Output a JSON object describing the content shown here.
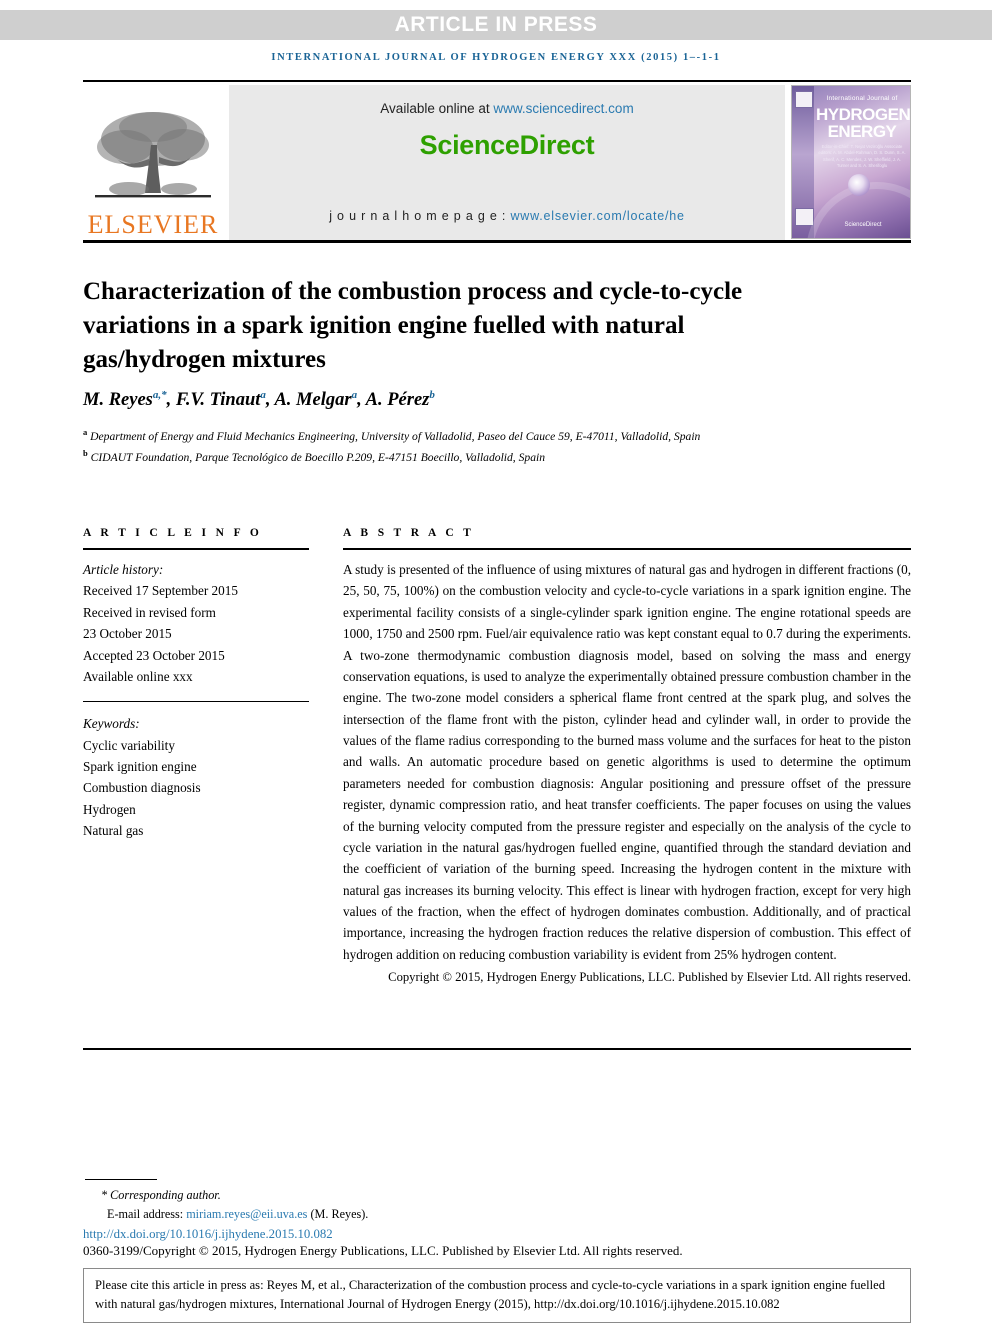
{
  "banner": {
    "text": "ARTICLE IN PRESS"
  },
  "running_head": {
    "text": "INTERNATIONAL JOURNAL OF HYDROGEN ENERGY XXX (2015) 1–‑1‑1"
  },
  "masthead": {
    "publisher_word": "ELSEVIER",
    "available_prefix": "Available online at ",
    "available_url": "www.sciencedirect.com",
    "sciencedirect_logo": "ScienceDirect",
    "homepage_prefix": "j o u r n a l   h o m e p a g e :  ",
    "homepage_url": "www.elsevier.com/locate/he",
    "cover": {
      "small_title": "International Journal of",
      "big_line1": "HYDROGEN",
      "big_line2": "ENERGY",
      "editors": "Editor-in-Chief: T. Nejat Veziroğlu   Associate editors: A. M. Abdel-Rahman, D. S. Dunn, S. A. Sherif, A. C. Mendes, J. W. Sheffield, J. A. Turner and S. A. Sherifoglu",
      "sciencedirect_mark": "ScienceDirect"
    }
  },
  "title": "Characterization of the combustion process and cycle-to-cycle variations in a spark ignition engine fuelled with natural gas/hydrogen mixtures",
  "authors": [
    {
      "name": "M. Reyes",
      "marks": "a,*"
    },
    {
      "name": "F.V. Tinaut",
      "marks": "a"
    },
    {
      "name": "A. Melgar",
      "marks": "a"
    },
    {
      "name": "A. Pérez",
      "marks": "b"
    }
  ],
  "affiliations": [
    {
      "mark": "a",
      "text": "Department of Energy and Fluid Mechanics Engineering, University of Valladolid, Paseo del Cauce 59, E-47011, Valladolid, Spain"
    },
    {
      "mark": "b",
      "text": "CIDAUT Foundation, Parque Tecnológico de Boecillo P.209, E-47151 Boecillo, Valladolid, Spain"
    }
  ],
  "article_info": {
    "heading": "A R T I C L E   I N F O",
    "history_label": "Article history:",
    "history": [
      "Received 17 September 2015",
      "Received in revised form",
      "23 October 2015",
      "Accepted 23 October 2015",
      "Available online xxx"
    ],
    "keywords_label": "Keywords:",
    "keywords": [
      "Cyclic variability",
      "Spark ignition engine",
      "Combustion diagnosis",
      "Hydrogen",
      "Natural gas"
    ]
  },
  "abstract": {
    "heading": "A B S T R A C T",
    "body": "A study is presented of the influence of using mixtures of natural gas and hydrogen in different fractions (0, 25, 50, 75, 100%) on the combustion velocity and cycle-to-cycle variations in a spark ignition engine. The experimental facility consists of a single-cylinder spark ignition engine. The engine rotational speeds are 1000, 1750 and 2500 rpm. Fuel/air equivalence ratio was kept constant equal to 0.7 during the experiments. A two-zone thermodynamic combustion diagnosis model, based on solving the mass and energy conservation equations, is used to analyze the experimentally obtained pressure combustion chamber in the engine. The two-zone model considers a spherical flame front centred at the spark plug, and solves the intersection of the flame front with the piston, cylinder head and cylinder wall, in order to provide the values of the flame radius corresponding to the burned mass volume and the surfaces for heat to the piston and walls. An automatic procedure based on genetic algorithms is used to determine the optimum parameters needed for combustion diagnosis: Angular positioning and pressure offset of the pressure register, dynamic compression ratio, and heat transfer coefficients. The paper focuses on using the values of the burning velocity computed from the pressure register and especially on the analysis of the cycle to cycle variation in the natural gas/hydrogen fuelled engine, quantified through the standard deviation and the coefficient of variation of the burning speed. Increasing the hydrogen content in the mixture with natural gas increases its burning velocity. This effect is linear with hydrogen fraction, except for very high values of the fraction, when the effect of hydrogen dominates combustion. Additionally, and of practical importance, increasing the hydrogen fraction reduces the relative dispersion of combustion. This effect of hydrogen addition on reducing combustion variability is evident from 25% hydrogen content.",
    "copyright": "Copyright © 2015, Hydrogen Energy Publications, LLC. Published by Elsevier Ltd. All rights reserved."
  },
  "footnotes": {
    "corresponding": "* Corresponding author.",
    "email_label": "E-mail address: ",
    "email": "miriam.reyes@eii.uva.es",
    "email_suffix": " (M. Reyes).",
    "doi": "http://dx.doi.org/10.1016/j.ijhydene.2015.10.082",
    "issn": "0360-3199/Copyright © 2015, Hydrogen Energy Publications, LLC. Published by Elsevier Ltd. All rights reserved."
  },
  "citation_box": {
    "text": "Please cite this article in press as: Reyes M, et al., Characterization of the combustion process and cycle-to-cycle variations in a spark ignition engine fuelled with natural gas/hydrogen mixtures, International Journal of Hydrogen Energy (2015), http://dx.doi.org/10.1016/j.ijhydene.2015.10.082"
  }
}
